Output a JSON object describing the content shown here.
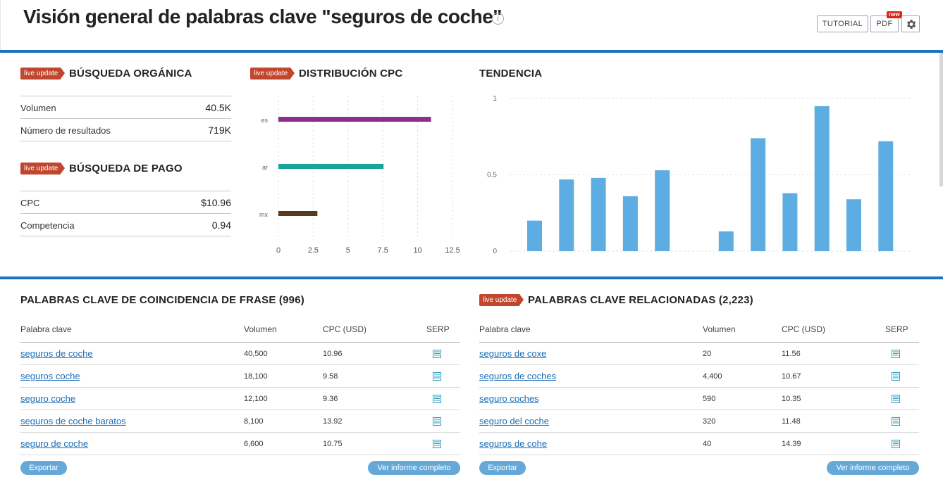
{
  "header": {
    "title": "Visión general de palabras clave \"seguros de coche\"",
    "tutorial_label": "TUTORIAL",
    "pdf_label": "PDF",
    "new_badge": "new"
  },
  "badges": {
    "live": "live update"
  },
  "organic": {
    "title": "BÚSQUEDA ORGÁNICA",
    "rows": [
      {
        "label": "Volumen",
        "value": "40.5K"
      },
      {
        "label": "Número de resultados",
        "value": "719K"
      }
    ]
  },
  "paid": {
    "title": "BÚSQUEDA DE PAGO",
    "rows": [
      {
        "label": "CPC",
        "value": "$10.96"
      },
      {
        "label": "Competencia",
        "value": "0.94"
      }
    ]
  },
  "cpc_distribution": {
    "title": "DISTRIBUCIÓN CPC",
    "chart_data": {
      "type": "bar",
      "orientation": "horizontal",
      "categories": [
        "es",
        "ar",
        "mx"
      ],
      "values": [
        10.96,
        7.55,
        2.8
      ],
      "colors": [
        "#8e2f8d",
        "#1aa39a",
        "#5a3a1e"
      ],
      "xlim": [
        0,
        12.5
      ],
      "xticks": [
        "0",
        "2.5",
        "5",
        "7.5",
        "10",
        "12.5"
      ],
      "grid": true
    }
  },
  "trend": {
    "title": "TENDENCIA",
    "chart_data": {
      "type": "bar",
      "values": [
        0.2,
        0.47,
        0.48,
        0.36,
        0.53,
        0,
        0.13,
        0.74,
        0.38,
        0.95,
        0.34,
        0.72
      ],
      "color": "#5dade2",
      "ylim": [
        0,
        1
      ],
      "yticks": [
        "0",
        "0.5",
        "1"
      ],
      "grid": true
    }
  },
  "phrase_match": {
    "title": "PALABRAS CLAVE DE COINCIDENCIA DE FRASE (996)",
    "headers": {
      "keyword": "Palabra clave",
      "volume": "Volumen",
      "cpc": "CPC (USD)",
      "serp": "SERP"
    },
    "rows": [
      {
        "keyword": "seguros de coche",
        "volume": "40,500",
        "cpc": "10.96"
      },
      {
        "keyword": "seguros coche",
        "volume": "18,100",
        "cpc": "9.58"
      },
      {
        "keyword": "seguro coche",
        "volume": "12,100",
        "cpc": "9.36"
      },
      {
        "keyword": "seguros de coche baratos",
        "volume": "8,100",
        "cpc": "13.92"
      },
      {
        "keyword": "seguro de coche",
        "volume": "6,600",
        "cpc": "10.75"
      }
    ],
    "export_label": "Exportar",
    "full_report_label": "Ver informe completo"
  },
  "related": {
    "title": "PALABRAS CLAVE RELACIONADAS (2,223)",
    "headers": {
      "keyword": "Palabra clave",
      "volume": "Volumen",
      "cpc": "CPC (USD)",
      "serp": "SERP"
    },
    "rows": [
      {
        "keyword": "seguros de coxe",
        "volume": "20",
        "cpc": "11.56"
      },
      {
        "keyword": "seguros de coches",
        "volume": "4,400",
        "cpc": "10.67"
      },
      {
        "keyword": "seguro coches",
        "volume": "590",
        "cpc": "10.35"
      },
      {
        "keyword": "seguro del coche",
        "volume": "320",
        "cpc": "11.48"
      },
      {
        "keyword": "seguros de cohe",
        "volume": "40",
        "cpc": "14.39"
      }
    ],
    "export_label": "Exportar",
    "full_report_label": "Ver informe completo"
  },
  "colors": {
    "accent": "#1a73c3",
    "live_badge": "#c0462d",
    "link": "#1a6cb5",
    "button": "#66a9d8"
  },
  "icons": [
    "info-icon",
    "gear-icon",
    "serp-icon"
  ]
}
